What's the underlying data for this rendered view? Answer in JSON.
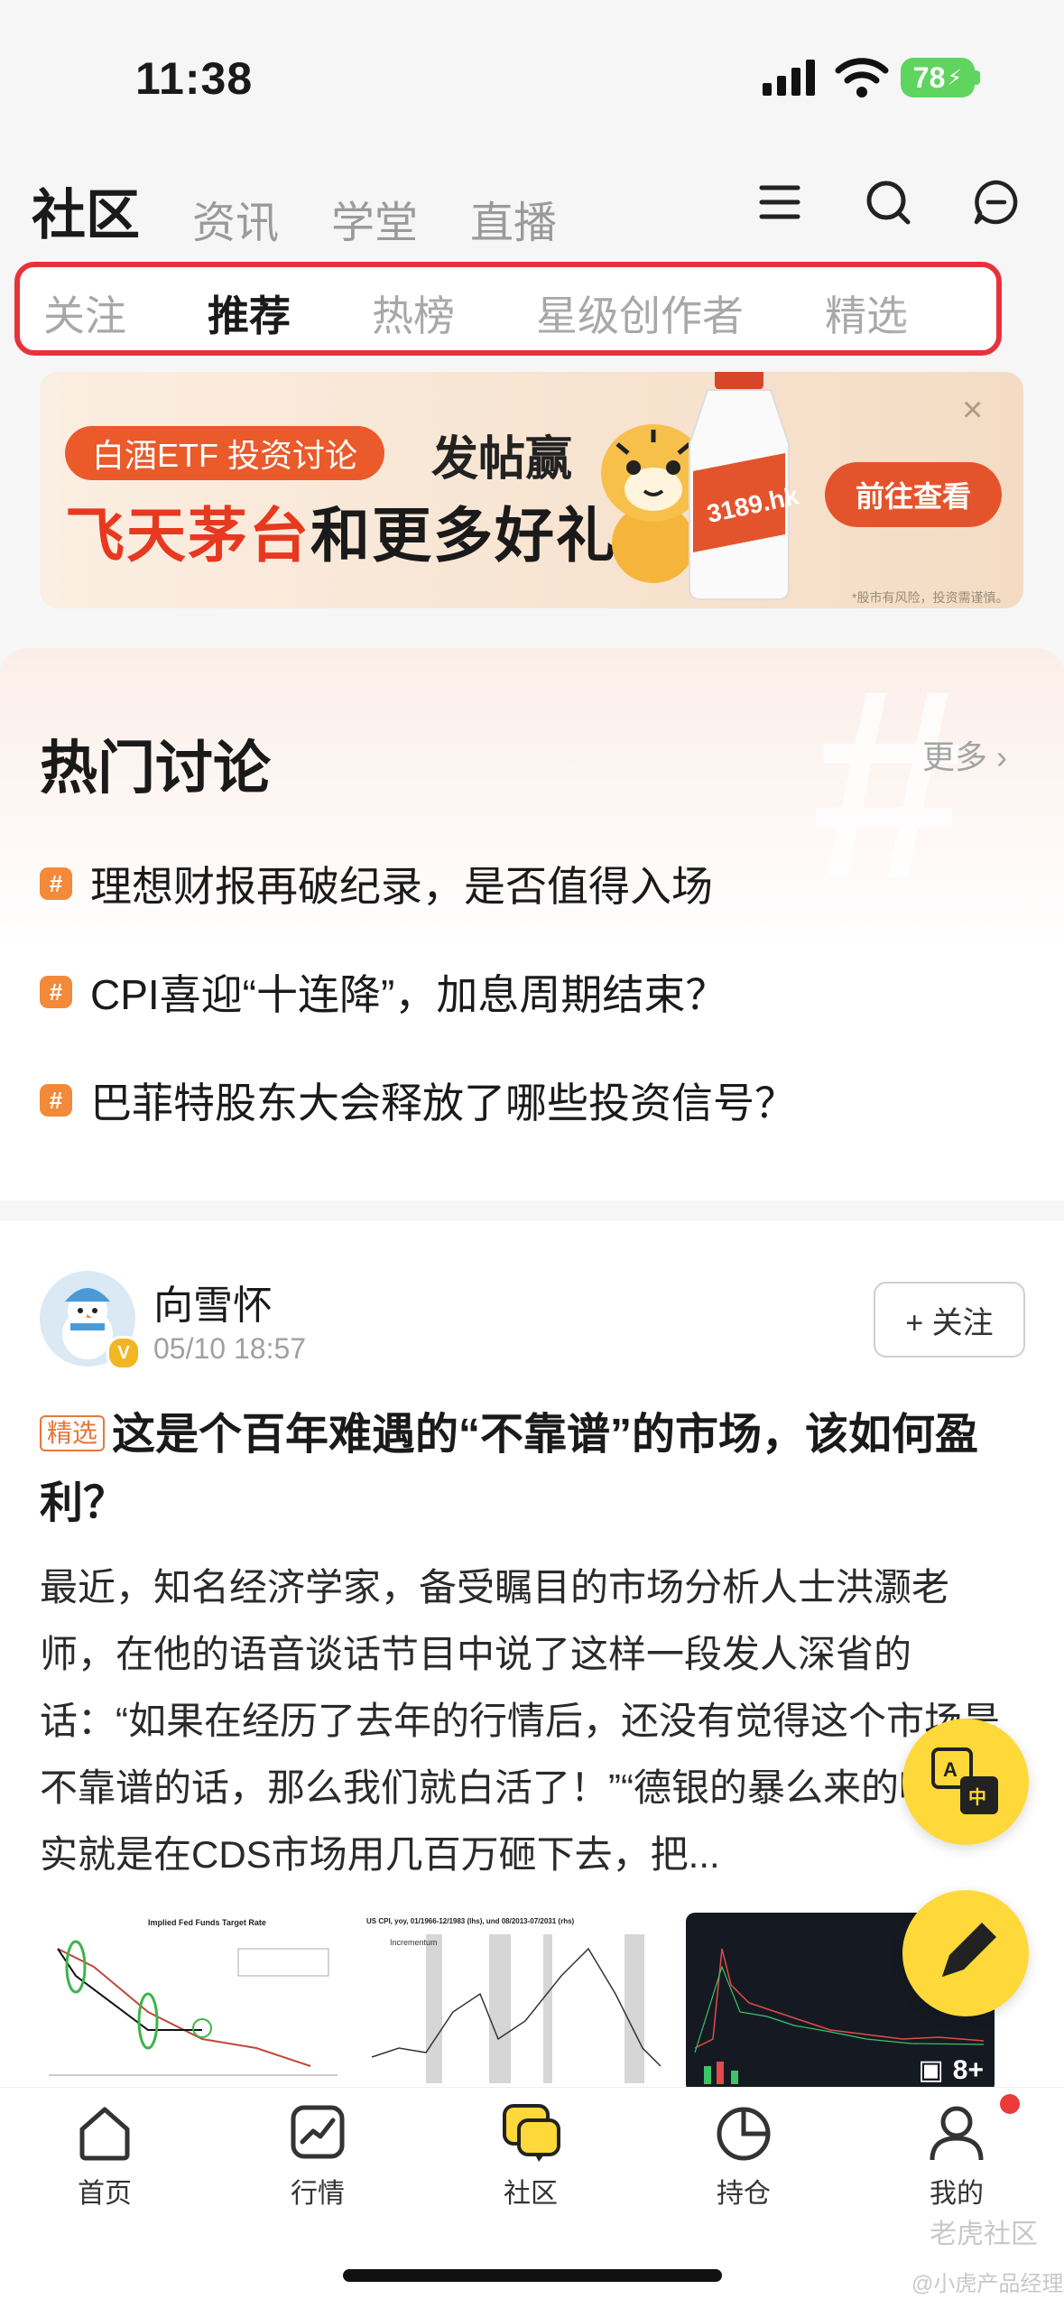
{
  "status_bar": {
    "time": "11:38",
    "battery": "78"
  },
  "top_nav": {
    "tabs": [
      "社区",
      "资讯",
      "学堂",
      "直播"
    ]
  },
  "sub_tabs": [
    "关注",
    "推荐",
    "热榜",
    "星级创作者",
    "精选"
  ],
  "banner": {
    "pill": "白酒ETF 投资讨论",
    "line1": "发帖赢",
    "line2_red": "飞天茅台",
    "line2_black": "和更多好礼",
    "cta": "前往查看",
    "close": "×",
    "bottle_text": "3189.hk",
    "disclaimer": "*股市有风险，投资需谨慎。"
  },
  "hot": {
    "title": "热门讨论",
    "more": "更多",
    "items": [
      "理想财报再破纪录，是否值得入场",
      "CPI喜迎“十连降”，加息周期结束？",
      "巴菲特股东大会释放了哪些投资信号？"
    ]
  },
  "post": {
    "author": "向雪怀",
    "time": "05/10 18:57",
    "follow": "+ 关注",
    "badge": "精选",
    "title": "这是个百年难遇的“不靠谱”的市场，该如何盈利？",
    "body": "最近，知名经济学家，备受瞩目的市场分析人士洪灏老师，在他的语音谈话节目中说了这样一段发人深省的话：“如果在经历了去年的行情后，还没有觉得这个市场是不靠谱的话，那么我们就白活了！”“德银的暴么来的呢？其实就是在CDS市场用几百万砸下去，把...",
    "thumb1_title": "Implied Fed Funds Target Rate",
    "thumb2_title": "US CPI, yoy, 01/1966-12/1983 (lhs), und 08/2013-07/2031 (rhs)",
    "thumb2_legend": "Incrementum",
    "more_images": "8+"
  },
  "tab_bar": {
    "items": [
      "首页",
      "行情",
      "社区",
      "持仓",
      "我的"
    ]
  },
  "watermark": {
    "line1": "老虎社区",
    "line2": "@小虎产品经理"
  }
}
